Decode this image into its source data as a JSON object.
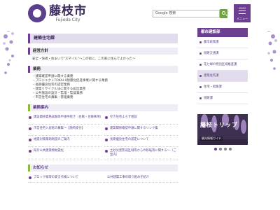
{
  "header": {
    "logo_jp": "藤枝市",
    "logo_en": "Fujieda City",
    "search_placeholder": "Google 検索",
    "menu_label": "メニュー"
  },
  "main": {
    "title": "建築住宅課",
    "overview": {
      "heading": "経営方針",
      "text": "安全・快適・住まいで\"スマイル\"～この街に、この家に住んでよかった～"
    },
    "business": {
      "heading": "業務",
      "items": [
        "建築確認申請に関する業務",
        "プロジェクトTOKAI-0耐震化促進事業に関する業務",
        "長期優良住宅の認定業務",
        "建築リサイクル法に関する届出業務",
        "公共施設の設計・監理・監督業務",
        "市営住宅の募集・管理業務"
      ]
    },
    "guide": {
      "heading": "業務案内",
      "links": [
        "建設関係資格試験等申請手続き（台帳・台帳事項）",
        "空き住宅よろず相談",
        "市営住宅入居者の募集～【随時受付】",
        "建築関係確認申請に関するリンク集",
        "地震対策補助制度のご案内",
        "長期優良住宅の認定について",
        "既存公共建築物耐震化",
        "土砂災害警戒区域等からの移転等に関する～（ご案内）"
      ]
    },
    "news": {
      "heading": "お知らせ",
      "items": [
        "ブロック塀等の安全点検について",
        "公共建築工事の取り組みを紹介"
      ]
    }
  },
  "sidebar": {
    "heading": "都市建設部",
    "items": [
      "都市政策課",
      "街路交通課",
      "花と緑の特別区域推進課",
      "建築住宅課",
      "住宅・街路課",
      "道路課"
    ],
    "active_index": 3,
    "banner_title": "藤枝トリップ",
    "banner_sub": "観光情報ガイド"
  },
  "colors": {
    "brand": "#6c3f93",
    "accent": "#8dbb3d",
    "search_button": "#6fa33b"
  }
}
